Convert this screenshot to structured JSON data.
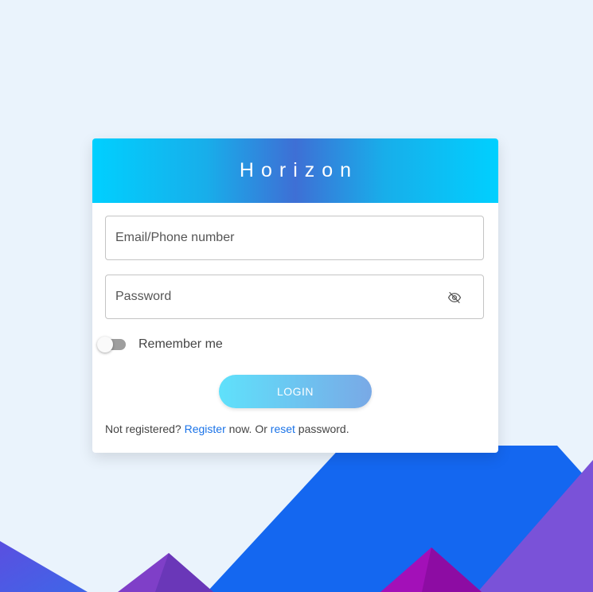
{
  "brand": {
    "title": "Horizon"
  },
  "login_form": {
    "email_placeholder": "Email/Phone number",
    "password_placeholder": "Password",
    "remember_label": "Remember me",
    "remember_checked": false,
    "login_label": "LOGIN"
  },
  "footer": {
    "prefix": "Not registered?",
    "register_link": "Register",
    "middle": "now. Or",
    "reset_link": "reset",
    "suffix": "password."
  },
  "icons": {
    "password_toggle": "eye-off-icon"
  },
  "colors": {
    "page_background": "#eaf3fc",
    "header_gradient_edge": "#00d0ff",
    "header_gradient_center": "#3e6fd5",
    "button_gradient_start": "#5fe1fb",
    "button_gradient_end": "#79a9e6",
    "link": "#1a73e8",
    "mountain_blue": "#1467f0",
    "mountain_violet": "#7a52d8",
    "mountain_magenta": "#a310b8"
  }
}
